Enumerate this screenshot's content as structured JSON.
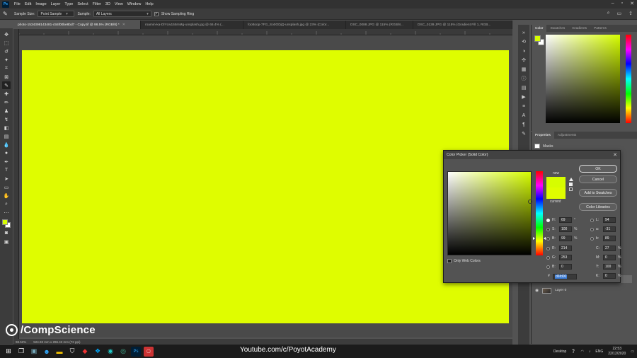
{
  "app": {
    "logo": "Ps"
  },
  "menu": [
    "File",
    "Edit",
    "Image",
    "Layer",
    "Type",
    "Select",
    "Filter",
    "3D",
    "View",
    "Window",
    "Help"
  ],
  "options": {
    "sample_size_label": "Sample Size:",
    "sample_size_value": "Point Sample",
    "sample_label": "Sample:",
    "sample_value": "All Layers",
    "show_ring_label": "Show Sampling Ring"
  },
  "tabs": [
    {
      "label": "photo-1534398143481-c55f00be8bd7 - Copy.tif @ 98.5% (RGB/8) *",
      "active": true
    },
    {
      "label": "roamin-ka-DlYcw155mMg-unsplash.jpg @ 66.4% (...",
      "active": false
    },
    {
      "label": "foottoop-7FG_So0ODjQ-unsplash.jpg @ 23% (Color...",
      "active": false
    },
    {
      "label": "DSC_0088.JPG @ 115% (RGB/8...",
      "active": false
    },
    {
      "label": "DSC_0139.JPG @ 115% (Gradient Fill 1, RGB...",
      "active": false
    }
  ],
  "canvas": {
    "fill": "#dffd00"
  },
  "status": {
    "zoom": "98.52%",
    "size": "524.93 mm x 296.42 mm (72 ppi)"
  },
  "watermark": "/CompScience",
  "color_panel": {
    "tabs": [
      "Color",
      "Swatches",
      "Gradients",
      "Patterns"
    ]
  },
  "properties_panel": {
    "tabs": [
      "Properties",
      "Adjustments"
    ],
    "masks_label": "Masks",
    "layer_name": "Layer 0"
  },
  "dialog": {
    "title": "Color Picker (Solid Color)",
    "new_label": "new",
    "current_label": "current",
    "buttons": {
      "ok": "OK",
      "cancel": "Cancel",
      "add_swatches": "Add to Swatches",
      "libraries": "Color Libraries"
    },
    "fields": {
      "H": "69",
      "S": "100",
      "B": "99",
      "R": "214",
      "G": "253",
      "Bl": "0",
      "L": "94",
      "a": "-31",
      "b": "89",
      "C": "27",
      "M": "0",
      "Y": "100",
      "K": "0"
    },
    "units": {
      "deg": "°",
      "pct": "%"
    },
    "hex_label": "#",
    "hex": "d6fd00",
    "web_colors_label": "Only Web Colors",
    "new_color": "#d6fd00",
    "current_color": "#dffd00"
  },
  "taskbar": {
    "youtube_text": "Youtube.com/c/PoyotAcademy",
    "desktop": "Desktop",
    "lang": "ENG",
    "time": "22:53",
    "date": "22/12/2020"
  }
}
